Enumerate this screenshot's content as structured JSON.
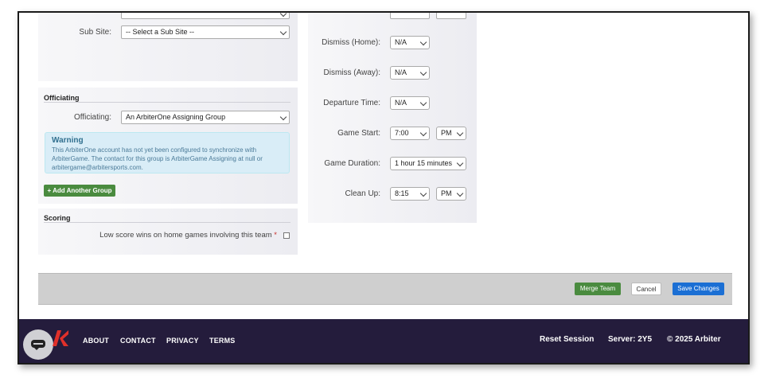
{
  "left": {
    "sub_site": {
      "label": "Sub Site:",
      "value": "-- Select a Sub Site --"
    },
    "officiating": {
      "section_title": "Officiating",
      "label": "Officiating:",
      "value": "An ArbiterOne Assigning Group",
      "warning_title": "Warning",
      "warning_text": "This ArbiterOne account has not yet been configured to synchronize with ArbiterGame. The contact for this group is ArbiterGame Assigning at null or arbitergame@arbitersports.com.",
      "add_button": "+ Add Another Group"
    },
    "scoring": {
      "section_title": "Scoring",
      "low_score_label": "Low score wins on home games involving this team",
      "required_mark": "*"
    }
  },
  "right": {
    "dismiss_home": {
      "label": "Dismiss (Home):",
      "value": "N/A"
    },
    "dismiss_away": {
      "label": "Dismiss (Away):",
      "value": "N/A"
    },
    "departure_time": {
      "label": "Departure Time:",
      "value": "N/A"
    },
    "game_start": {
      "label": "Game Start:",
      "time": "7:00",
      "ampm": "PM"
    },
    "game_duration": {
      "label": "Game Duration:",
      "value": "1 hour 15 minutes"
    },
    "clean_up": {
      "label": "Clean Up:",
      "time": "8:15",
      "ampm": "PM"
    }
  },
  "actions": {
    "merge": "Merge Team",
    "cancel": "Cancel",
    "save": "Save Changes"
  },
  "footer": {
    "links": [
      "ABOUT",
      "CONTACT",
      "PRIVACY",
      "TERMS"
    ],
    "reset_session": "Reset Session",
    "server": "Server: 2Y5",
    "copyright": "© 2025 Arbiter"
  },
  "colors": {
    "footer_bg": "#241c3c",
    "green": "#4a8b3f",
    "blue": "#1b6fd4",
    "logo_red": "#e0302a"
  }
}
